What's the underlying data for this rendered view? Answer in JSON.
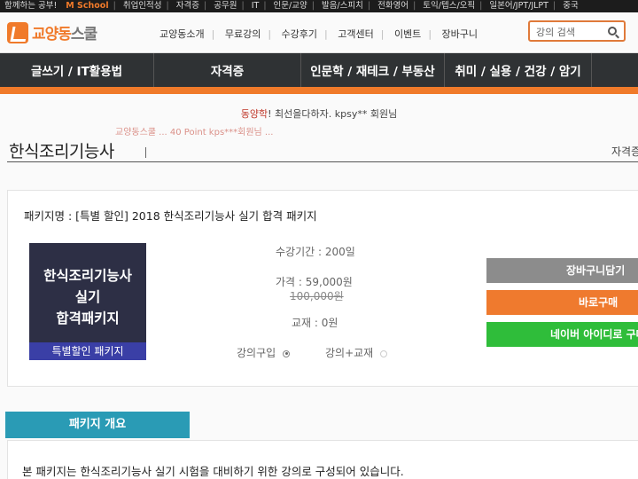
{
  "topbar": {
    "items": [
      "함께하는 공부!",
      "취업인적성",
      "자격증",
      "공무원",
      "IT",
      "인문/교양",
      "발음/스피치",
      "전화영어",
      "토익/텝스/오픽",
      "일본어/JPT/JLPT",
      "중국"
    ],
    "highlight": "M School"
  },
  "header": {
    "logo_main": "교양동",
    "logo_sub": "스쿨",
    "nav": [
      "교양동소개",
      "무료강의",
      "수강후기",
      "고객센터",
      "이벤트",
      "장바구니"
    ],
    "search_placeholder": "강의 검색"
  },
  "category_nav": [
    "글쓰기 / IT활용법",
    "자격증",
    "인문학 / 재테크 / 부동산",
    "취미 / 실용 / 건강 / 암기"
  ],
  "notice": {
    "accent": "동양학",
    "text": "! 최선을다하자. kpsy** 회원님",
    "line2": "교양동스쿨 ... 40 Point kps***회원님 ..."
  },
  "page": {
    "title": "한식조리기능사",
    "breadcrumb": "자격증"
  },
  "package": {
    "name": "패키지명 : [특별 할인] 2018 한식조리기능사 실기 합격 패키지",
    "thumb_line1": "한식조리기능사",
    "thumb_line2": "실기",
    "thumb_line3": "합격패키지",
    "thumb_band": "특별할인 패키지",
    "period": "수강기간 : 200일",
    "price": "가격 : 59,000원",
    "original_price": "100,000원",
    "textbook": "교재 : 0원",
    "option_lecture": "강의구입",
    "option_lecture_book": "강의+교재",
    "btn_cart": "장바구니담기",
    "btn_buy": "바로구매",
    "btn_naver": "네이버 아이디로 구매"
  },
  "overview": {
    "tab": "패키지 개요",
    "text": "본 패키지는 한식조리기능사 실기 시험을 대비하기 위한 강의로 구성되어 있습니다."
  },
  "colors": {
    "accent_orange": "#f07a2a",
    "nav_dark": "#2f3234",
    "naver_green": "#2fbd3a",
    "tab_teal": "#2a9bb5"
  }
}
